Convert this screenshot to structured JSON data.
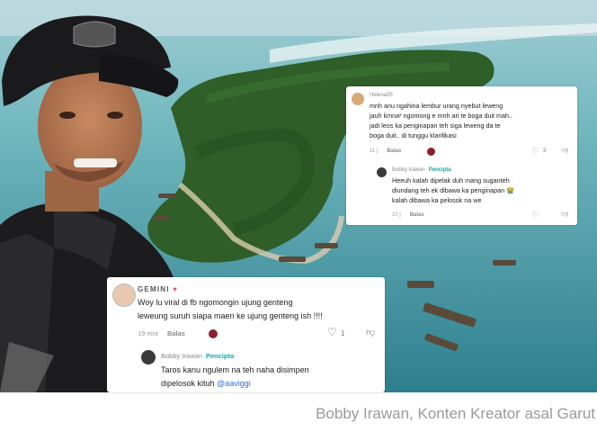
{
  "photo": {
    "subject": "smiling man in black cap in front of aerial view of tropical island",
    "colors": {
      "sea_deep": "#3f8f9e",
      "sea_shallow": "#78c1c3",
      "forest": "#2d5a26",
      "sky": "#cfe3ea"
    }
  },
  "comment1": {
    "username": "Helena05",
    "lines": [
      "mnh anu ngahina lembur urang nyebut leweng",
      "jauh kmna² ngomong e mnh ari te boga duit mah..",
      "jadi leos ka penginapan teh siga leweng da te",
      "boga duit.. di tunggu klarifikasi"
    ],
    "time": "11 j",
    "reply_label": "Balas",
    "likes": "3",
    "reply": {
      "username": "Bobby Irawan",
      "badge": "Pencipta",
      "lines": [
        "Heeuh kalah dipelak duh mang suganteh",
        "diundang teh ek dibawa ka penginapan 😭",
        "kalah dibawa ka pelosok na we"
      ],
      "time": "10 j",
      "reply_label": "Balas"
    }
  },
  "comment2": {
    "username": "GEMINI",
    "lines": [
      "Woy lu viral di fb ngomongin ujung genteng",
      "leweung suruh siapa maen ke ujung genteng ish !!!!"
    ],
    "time": "19 mnt",
    "reply_label": "Balas",
    "likes": "1",
    "reply": {
      "username": "Bobby Irawan",
      "badge": "Pencipta",
      "line1": "Taros kanu ngulem na teh naha disimpen",
      "line2_text": "dipelosok kituh ",
      "mention": "@aaviggi"
    }
  },
  "caption": "Bobby Irawan, Konten Kreator asal Garut"
}
